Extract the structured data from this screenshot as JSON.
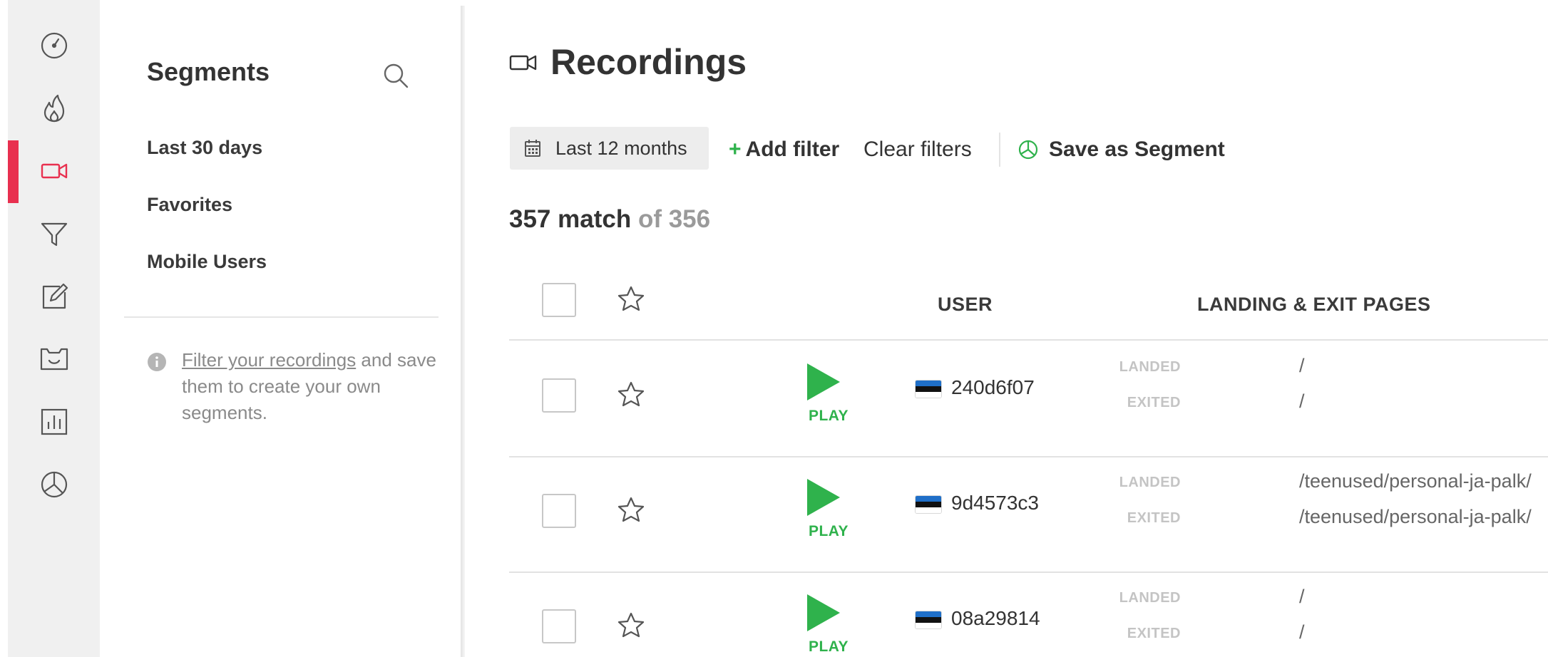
{
  "colors": {
    "accent": "#e8304f",
    "play": "#2fb24c",
    "flag_blue": "#1f6fc8",
    "flag_black": "#111111"
  },
  "rail": {
    "items": [
      {
        "icon": "dashboard-gauge-icon"
      },
      {
        "icon": "heatmap-flame-icon"
      },
      {
        "icon": "recordings-camera-icon",
        "active": true
      },
      {
        "icon": "funnels-filter-icon"
      },
      {
        "icon": "forms-edit-icon"
      },
      {
        "icon": "feedback-smile-icon"
      },
      {
        "icon": "analytics-bar-chart-icon"
      },
      {
        "icon": "segments-pie-icon"
      }
    ],
    "collapse_icon": "chevron-right-icon"
  },
  "segments": {
    "title": "Segments",
    "items": [
      "Last 30 days",
      "Favorites",
      "Mobile Users"
    ],
    "info_link": "Filter your recordings",
    "info_rest": " and save them to create your own segments."
  },
  "main": {
    "title": "Recordings",
    "toolbar": {
      "date_range": "Last 12 months",
      "add_filter_plus": "+",
      "add_filter": "Add filter",
      "clear_filters": "Clear filters",
      "save_segment": "Save as Segment"
    },
    "match_count": "357 match",
    "match_total": "of 356",
    "columns": {
      "user": "USER",
      "pages": "LANDING & EXIT PAGES"
    },
    "landed_label": "LANDED",
    "exited_label": "EXITED",
    "play_label": "PLAY",
    "rows": [
      {
        "user": "240d6f07",
        "landed": "/",
        "exited": "/"
      },
      {
        "user": "9d4573c3",
        "landed": "/teenused/personal-ja-palk/",
        "exited": "/teenused/personal-ja-palk/"
      },
      {
        "user": "08a29814",
        "landed": "/",
        "exited": "/"
      }
    ]
  }
}
